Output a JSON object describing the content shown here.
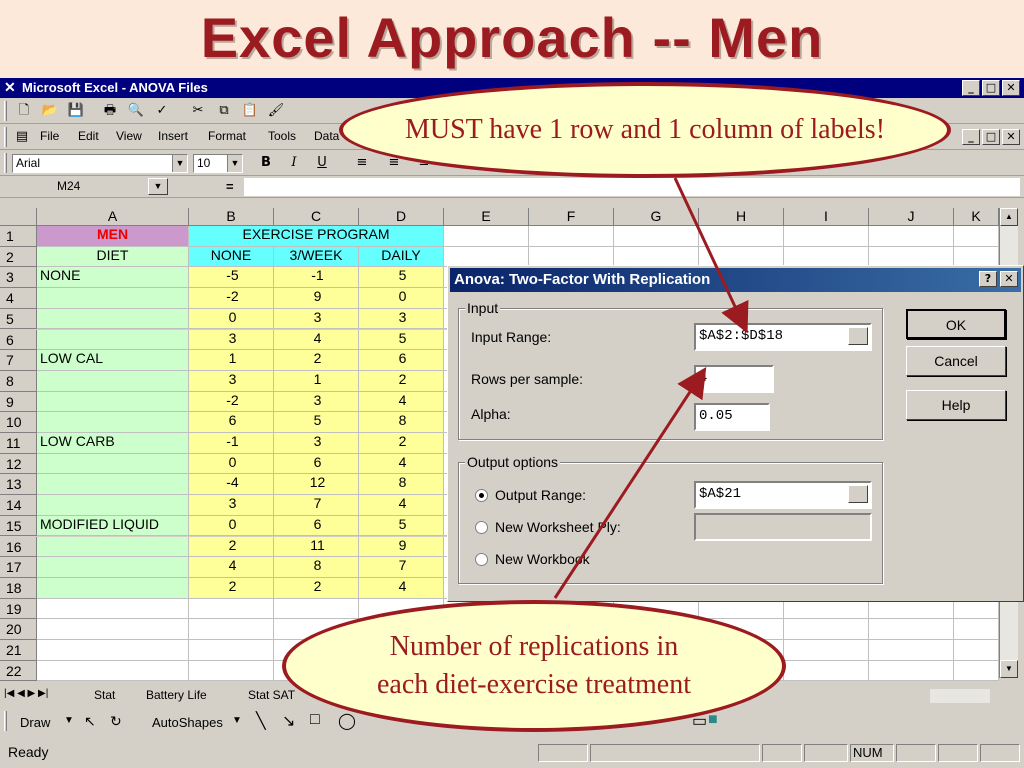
{
  "slide": {
    "title": "Excel Approach -- Men"
  },
  "window": {
    "title": "Microsoft Excel - ANOVA Files",
    "controls": [
      "_",
      "□",
      "✕"
    ]
  },
  "menu": {
    "items": [
      "File",
      "Edit",
      "View",
      "Insert",
      "Format",
      "Tools",
      "Data"
    ]
  },
  "format_bar": {
    "font": "Arial",
    "size": "10"
  },
  "formula_bar": {
    "name_box": "M24",
    "equals": "="
  },
  "sheet": {
    "columns": [
      "A",
      "B",
      "C",
      "D",
      "E",
      "F",
      "G",
      "H",
      "I",
      "J",
      "K"
    ],
    "row_numbers": [
      "1",
      "2",
      "3",
      "4",
      "5",
      "6",
      "7",
      "8",
      "9",
      "10",
      "11",
      "12",
      "13",
      "14",
      "15",
      "16",
      "17",
      "18",
      "19",
      "20",
      "21",
      "22"
    ],
    "header_men": "MEN",
    "header_exercise": "EXERCISE PROGRAM",
    "header_diet": "DIET",
    "sub_headers": [
      "NONE",
      "3/WEEK",
      "DAILY"
    ],
    "rows": [
      {
        "a": "NONE",
        "b": "-5",
        "c": "-1",
        "d": "5"
      },
      {
        "a": "",
        "b": "-2",
        "c": "9",
        "d": "0"
      },
      {
        "a": "",
        "b": "0",
        "c": "3",
        "d": "3"
      },
      {
        "a": "",
        "b": "3",
        "c": "4",
        "d": "5"
      },
      {
        "a": "LOW CAL",
        "b": "1",
        "c": "2",
        "d": "6"
      },
      {
        "a": "",
        "b": "3",
        "c": "1",
        "d": "2"
      },
      {
        "a": "",
        "b": "-2",
        "c": "3",
        "d": "4"
      },
      {
        "a": "",
        "b": "6",
        "c": "5",
        "d": "8"
      },
      {
        "a": "LOW CARB",
        "b": "-1",
        "c": "3",
        "d": "2"
      },
      {
        "a": "",
        "b": "0",
        "c": "6",
        "d": "4"
      },
      {
        "a": "",
        "b": "-4",
        "c": "12",
        "d": "8"
      },
      {
        "a": "",
        "b": "3",
        "c": "7",
        "d": "4"
      },
      {
        "a": "MODIFIED LIQUID",
        "b": "0",
        "c": "6",
        "d": "5"
      },
      {
        "a": "",
        "b": "2",
        "c": "11",
        "d": "9"
      },
      {
        "a": "",
        "b": "4",
        "c": "8",
        "d": "7"
      },
      {
        "a": "",
        "b": "2",
        "c": "2",
        "d": "4"
      }
    ],
    "tabs": [
      "Stat",
      "Battery Life",
      "Stat SAT"
    ]
  },
  "dialog": {
    "title": "Anova: Two-Factor With Replication",
    "help_q": "?",
    "input_group": "Input",
    "input_range_label": "Input Range:",
    "input_range_value": "$A$2:$D$18",
    "rows_label": "Rows per sample:",
    "rows_value": "4",
    "alpha_label": "Alpha:",
    "alpha_value": "0.05",
    "output_group": "Output options",
    "output_range_label": "Output Range:",
    "output_range_value": "$A$21",
    "new_ply_label": "New Worksheet Ply:",
    "new_workbook_label": "New Workbook",
    "ok": "OK",
    "cancel": "Cancel",
    "help": "Help"
  },
  "drawing_bar": {
    "draw": "Draw",
    "autoshapes": "AutoShapes"
  },
  "status": {
    "ready": "Ready",
    "num": "NUM"
  },
  "callouts": {
    "top": "MUST have 1 row and 1 column of labels!",
    "bottom_line1": "Number of replications in",
    "bottom_line2": "each diet-exercise treatment"
  },
  "colors": {
    "title": "#9b1b20",
    "background": "#fde9d9",
    "callout_fill": "#ffffcc"
  }
}
